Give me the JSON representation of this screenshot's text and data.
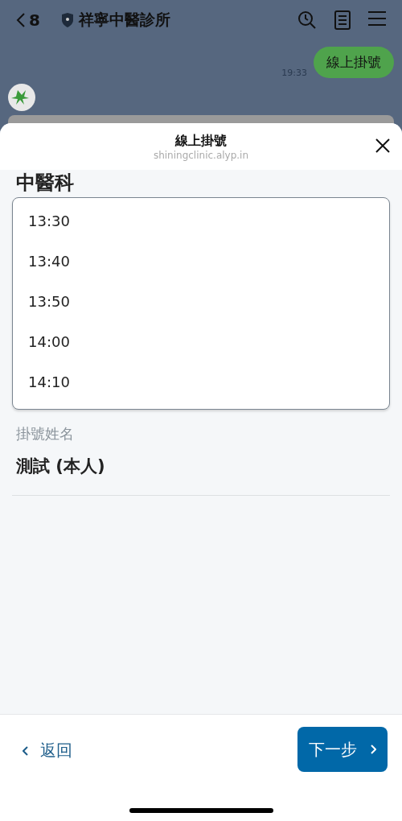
{
  "chat": {
    "back_count": "8",
    "title": "祥寧中醫診所",
    "message": {
      "text": "線上掛號",
      "time": "19:33"
    }
  },
  "sheet": {
    "title": "線上掛號",
    "url": "shiningclinic.alyp.in"
  },
  "department": "中醫科",
  "time_list": [
    {
      "label": "13:30"
    },
    {
      "label": "13:40"
    },
    {
      "label": "13:50"
    },
    {
      "label": "14:00"
    },
    {
      "label": "14:10"
    }
  ],
  "name_field": {
    "label": "掛號姓名",
    "value": "測試 (本人)"
  },
  "footer": {
    "back": "返回",
    "next": "下一步"
  }
}
